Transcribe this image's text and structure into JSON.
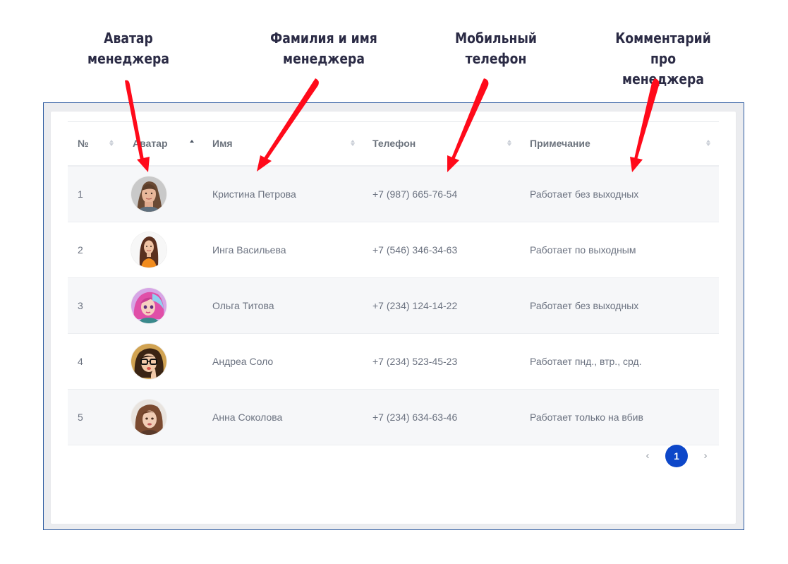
{
  "callouts": {
    "avatar": [
      "Аватар",
      "менеджера"
    ],
    "name": [
      "Фамилия и имя",
      "менеджера"
    ],
    "phone": [
      "Мобильный",
      "телефон"
    ],
    "comment": [
      "Комментарий",
      "про менеджера"
    ]
  },
  "table": {
    "headers": {
      "num": "№",
      "avatar": "Аватар",
      "name": "Имя",
      "phone": "Телефон",
      "note": "Примечание"
    },
    "sorted_column": "avatar",
    "rows": [
      {
        "num": "1",
        "name": "Кристина Петрова",
        "phone": "+7 (987) 665-76-54",
        "note": "Работает без выходных",
        "avatar_icon": "woman-1-avatar"
      },
      {
        "num": "2",
        "name": "Инга Васильева",
        "phone": "+7 (546) 346-34-63",
        "note": "Работает по выходным",
        "avatar_icon": "woman-2-avatar"
      },
      {
        "num": "3",
        "name": "Ольга Титова",
        "phone": "+7 (234) 124-14-22",
        "note": "Работает без выходных",
        "avatar_icon": "cartoon-girl-avatar"
      },
      {
        "num": "4",
        "name": "Андреа Соло",
        "phone": "+7 (234) 523-45-23",
        "note": "Работает пнд., втр., срд.",
        "avatar_icon": "glasses-girl-avatar"
      },
      {
        "num": "5",
        "name": "Анна Соколова",
        "phone": "+7 (234) 634-63-46",
        "note": "Работает только на вбив",
        "avatar_icon": "woman-3-avatar"
      }
    ]
  },
  "pagination": {
    "prev_icon": "chevron-left-icon",
    "current_page": "1",
    "next_icon": "chevron-right-icon"
  },
  "colors": {
    "accent": "#0d47c9",
    "arrow": "#ff0a1a",
    "callout_text": "#2b2b45",
    "frame_border": "#2c5aa0"
  }
}
